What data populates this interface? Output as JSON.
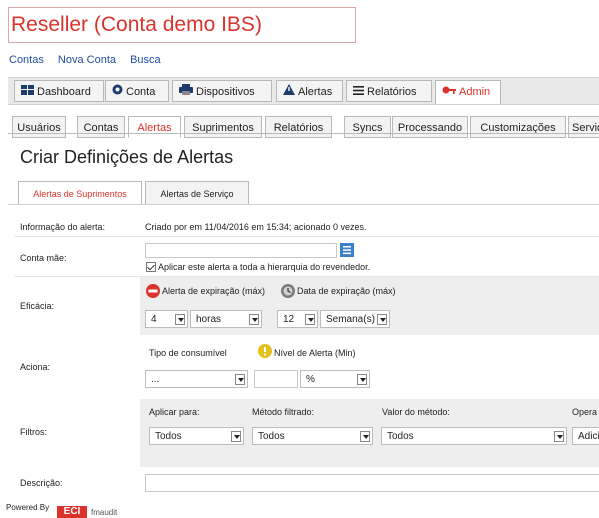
{
  "header": {
    "title": "Reseller (Conta demo IBS)",
    "links": [
      "Contas",
      "Nova Conta",
      "Busca"
    ]
  },
  "main_tabs": [
    {
      "label": "Dashboard",
      "icon": "dashboard-icon"
    },
    {
      "label": "Conta",
      "icon": "account-icon"
    },
    {
      "label": "Dispositivos",
      "icon": "printer-icon"
    },
    {
      "label": "Alertas",
      "icon": "alert-icon"
    },
    {
      "label": "Relatórios",
      "icon": "list-icon"
    },
    {
      "label": "Admin",
      "icon": "key-icon",
      "active": true
    }
  ],
  "sub_tabs": [
    "Usuários",
    "Contas",
    "Alertas",
    "Suprimentos",
    "Relatórios",
    "Syncs",
    "Processando",
    "Customizações",
    "Servido"
  ],
  "active_sub_tab": "Alertas",
  "page_heading": "Criar Definições de Alertas",
  "alert_tabs": [
    "Alertas de Suprimentos",
    "Alertas de Serviço"
  ],
  "form": {
    "info_label": "Informação do alerta:",
    "info_value": "Criado por em 11/04/2016 em 15:34; acionado 0 vezes.",
    "parent_label": "Conta mãe:",
    "parent_value": "",
    "apply_hierarchy": "Aplicar este alerta a toda a hierarquia do revendedor.",
    "efficacy_label": "Eficácia:",
    "expiry_alert": "Alerta de expiração (máx)",
    "expiry_date": "Data de expiração (máx)",
    "expiry_alert_value": "4",
    "expiry_alert_unit": "horas",
    "expiry_date_value": "12",
    "expiry_date_unit": "Semana(s)",
    "trigger_label": "Aciona:",
    "consumable_type": "Tipo de consumível",
    "alert_level": "Nível de Alerta (Min)",
    "consumable_value": "...",
    "level_value": "",
    "level_unit": "%",
    "filters_label": "Filtros:",
    "apply_to": "Aplicar para:",
    "filter_method": "Método filtrado:",
    "method_value": "Valor do método:",
    "operator": "Opera",
    "apply_to_value": "Todos",
    "filter_method_value": "Todos",
    "method_value_value": "Todos",
    "operator_value": "Adici",
    "description_label": "Descrição:",
    "description_value": ""
  },
  "footer": {
    "powered_by": "Powered By",
    "logo": "ECI",
    "logo_text": "fmaudit"
  },
  "colors": {
    "accent": "#d9342b",
    "link": "#1f4f9f"
  }
}
